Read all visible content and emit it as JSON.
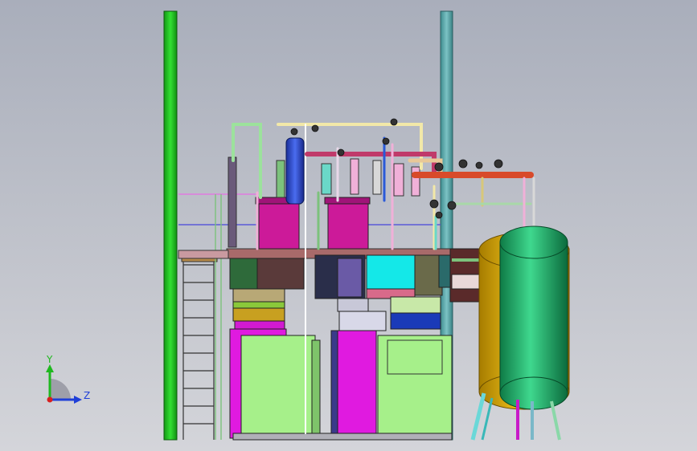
{
  "view": {
    "type": "3d-cad-model-viewport",
    "background_top": "#a9aebb",
    "background_bottom": "#d4d5da"
  },
  "triad": {
    "y_label": "Y",
    "z_label": "Z",
    "colors": {
      "y": "#1fb81f",
      "z": "#1f3fd8",
      "origin": "#d81f1f"
    }
  },
  "colors": {
    "stack_green": "#22cc22",
    "stack_teal": "#5aa3a6",
    "tank_green": "#1aa866",
    "tank_gold": "#d6a400",
    "magenta": "#d11aa6",
    "lime_box": "#9cf27a",
    "cyan_box": "#14e8e8"
  }
}
